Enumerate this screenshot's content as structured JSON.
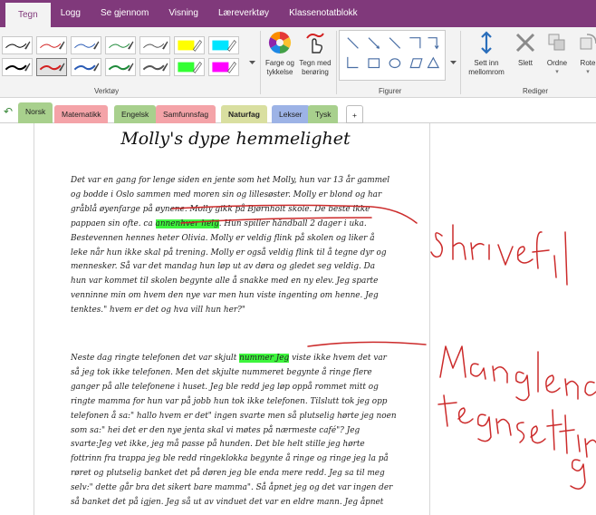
{
  "ribbon_tabs": [
    "Tegn",
    "Logg",
    "Se gjennom",
    "Visning",
    "Læreverktøy",
    "Klassenotatblokk"
  ],
  "active_tab": "Tegn",
  "ribbon": {
    "groups": {
      "tools": "Verktøy",
      "shapes": "Figurer",
      "edit": "Rediger"
    },
    "color_thickness": "Farge og\ntykkelse",
    "draw_touch": "Tegn med\nberøring",
    "insert_space": "Sett inn\nmellomrom",
    "delete": "Slett",
    "arrange": "Ordne",
    "rotate": "Rote"
  },
  "pen_colors": [
    "#000000",
    "#d22020",
    "#2a5bb5",
    "#1f8a3a",
    "#555555",
    "#ffff00",
    "#00e5ff",
    "#000000",
    "#d22020",
    "#2a5bb5",
    "#1f8a3a",
    "#555555",
    "#33ff33",
    "#ff00ff"
  ],
  "section_tabs": [
    {
      "label": "Norsk",
      "color": "#a8d08d",
      "bold": false
    },
    {
      "label": "Matematikk",
      "color": "#f4a3a8",
      "bold": false
    },
    {
      "label": "Engelsk",
      "color": "#a8d08d",
      "bold": false
    },
    {
      "label": "Samfunnsfag",
      "color": "#f4a3a8",
      "bold": false
    },
    {
      "label": "Naturfag",
      "color": "#d9dfa0",
      "bold": true
    },
    {
      "label": "Lekser",
      "color": "#9db3e6",
      "bold": false
    },
    {
      "label": "Tysk",
      "color": "#a8d08d",
      "bold": false
    },
    {
      "label": "+",
      "color": "#ffffff",
      "bold": false
    }
  ],
  "page": {
    "title": "Molly's dype hemmelighet",
    "paragraph1": [
      "Det var en gang for lenge siden en jente som het Molly, hun var 13 år gammel",
      "og bodde i Oslo sammen med moren sin og lillesøster. Molly er blond og har",
      "gråblå øyenfarge på øynene. Molly gikk på Bjørnholt skole. De beste ikke",
      [
        "pappaen sin ofte. ca ",
        "annenhver helg",
        ". Hun spiller håndball 2 dager i uka."
      ],
      "Bestevennen hennes heter Olivia. Molly er veldig flink på skolen og liker å",
      "leke når hun ikke skal på trening. Molly er også veldig flink til å tegne dyr og",
      "mennesker. Så var det mandag hun løp ut av døra og gledet seg veldig. Da",
      "hun var kommet til skolen begynte alle å snakke med en ny elev. Jeg sparte",
      "venninne min om hvem den nye var men hun viste ingenting om henne. Jeg",
      "tenktes.\" hvem er det og hva vill hun her?\""
    ],
    "paragraph2": [
      [
        "Neste dag ringte telefonen det var skjult ",
        "nummer Jeg",
        " viste ikke hvem det var"
      ],
      "så jeg tok ikke telefonen. Men det skjulte nummeret begynte å ringe flere",
      "ganger på alle telefonene i huset. Jeg ble redd jeg løp oppå rommet mitt og",
      "ringte mamma for hun var på jobb hun tok ikke telefonen. Tilslutt tok jeg opp",
      "telefonen å sa:\" hallo hvem er det\" ingen svarte men så plutselig hørte jeg noen",
      "som sa:\" hei det er den nye jenta skal vi møtes på nærmeste café\"? Jeg",
      "svarte:Jeg vet ikke, jeg må passe på hunden. Det ble helt stille jeg hørte",
      "fottrinn fra trappa jeg ble redd ringeklokka begynte å ringe og ringe jeg la på",
      "røret og plutselig banket det på døren jeg ble enda mere redd. Jeg sa til meg",
      "selv:\" dette går bra det sikert bare mamma\". Så åpnet jeg og det var ingen der",
      "så banket det på igjen. Jeg så ut av vinduet det var en eldre mann. Jeg åpnet"
    ]
  }
}
